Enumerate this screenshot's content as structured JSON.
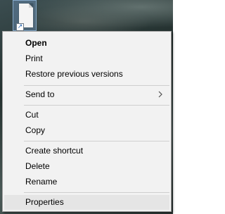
{
  "desktop": {
    "file_icon": "document-shortcut-icon",
    "shortcut_overlay_icon": "shortcut-arrow-icon"
  },
  "context_menu": {
    "items": [
      {
        "label": "Open"
      },
      {
        "label": "Print"
      },
      {
        "label": "Restore previous versions"
      },
      {
        "label": "Send to",
        "submenu_icon": "chevron-right-icon"
      },
      {
        "label": "Cut"
      },
      {
        "label": "Copy"
      },
      {
        "label": "Create shortcut"
      },
      {
        "label": "Delete"
      },
      {
        "label": "Rename"
      },
      {
        "label": "Properties"
      }
    ],
    "colors": {
      "background": "#f2f2f2",
      "highlight": "#e5e5e5",
      "separator": "#cfcfcf",
      "border": "#a0a0a0"
    }
  }
}
